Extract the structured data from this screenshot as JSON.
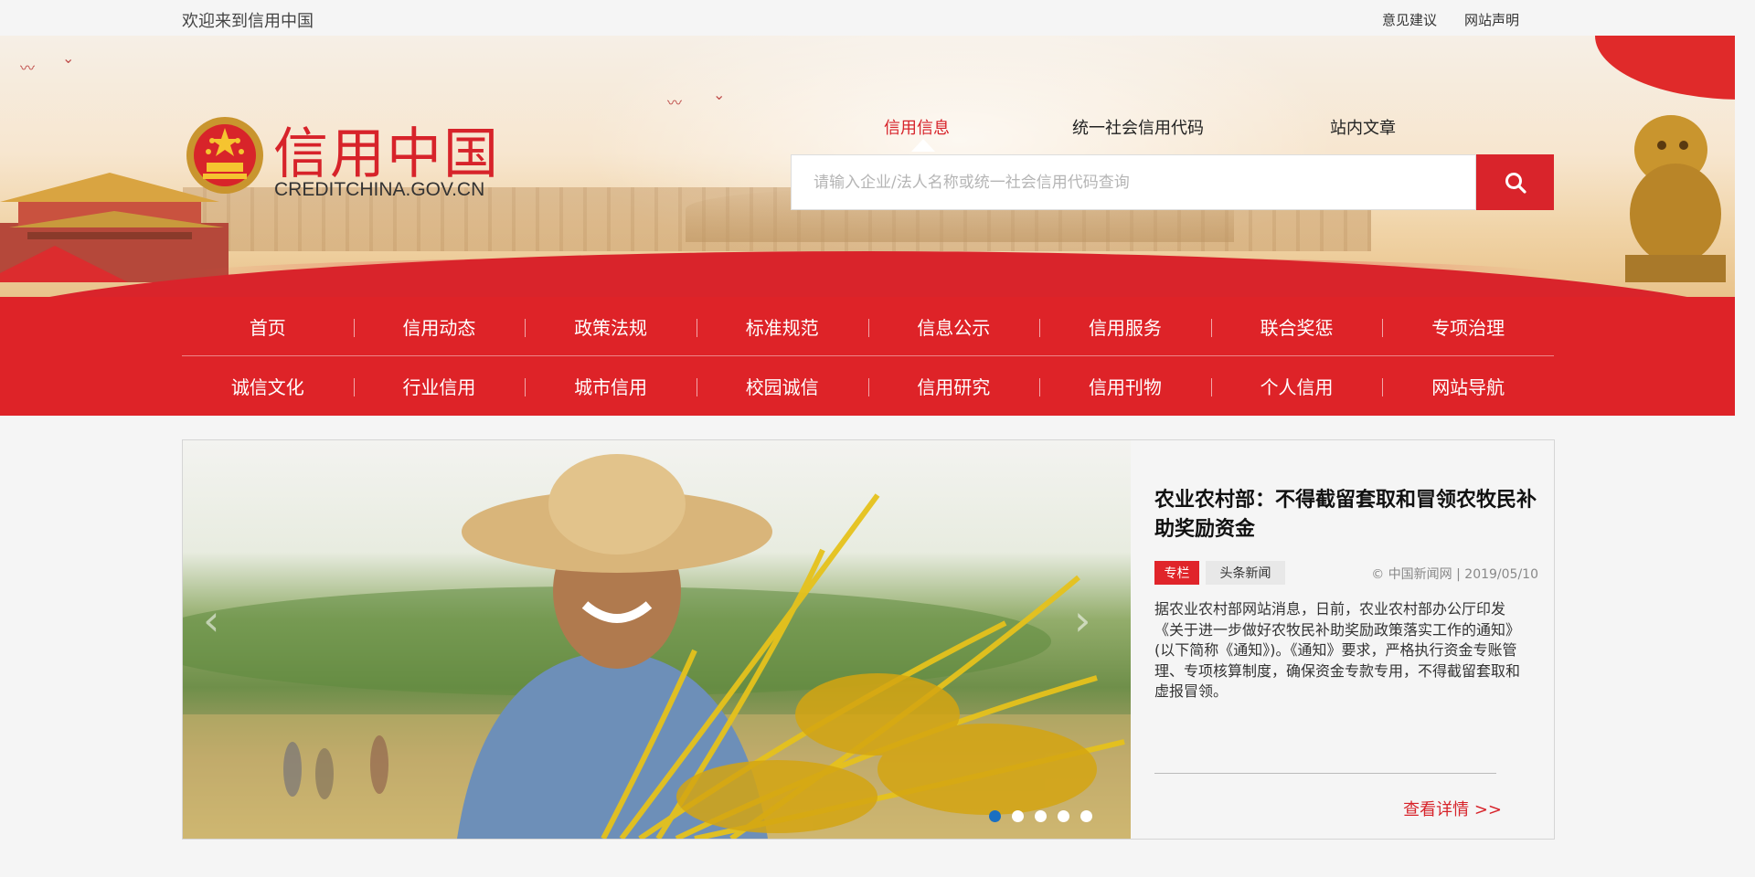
{
  "topbar": {
    "welcome": "欢迎来到信用中国",
    "links": [
      "意见建议",
      "网站声明"
    ]
  },
  "header": {
    "site_title": "信用中国",
    "site_domain": "CREDITCHINA.GOV.CN"
  },
  "search": {
    "tabs": [
      "信用信息",
      "统一社会信用代码",
      "站内文章"
    ],
    "active_tab": "信用信息",
    "placeholder": "请输入企业/法人名称或统一社会信用代码查询",
    "value": ""
  },
  "nav": {
    "row1": [
      "首页",
      "信用动态",
      "政策法规",
      "标准规范",
      "信息公示",
      "信用服务",
      "联合奖惩",
      "专项治理"
    ],
    "row2": [
      "诚信文化",
      "行业信用",
      "城市信用",
      "校园诚信",
      "信用研究",
      "信用刊物",
      "个人信用",
      "网站导航"
    ]
  },
  "featured": {
    "title": "农业农村部：不得截留套取和冒领农牧民补助奖励资金",
    "tags": [
      "专栏",
      "头条新闻"
    ],
    "source": "中国新闻网 | 2019/05/10",
    "summary": "据农业农村部网站消息，日前，农业农村部办公厅印发《关于进一步做好农牧民补助奖励政策落实工作的通知》(以下简称《通知》)。《通知》要求，严格执行资金专账管理、专项核算制度，确保资金专款专用，不得截留套取和虚报冒领。",
    "more_label": "查看详情 >>",
    "slide_count": 5,
    "active_slide": 1
  },
  "colors": {
    "brand_red": "#de2328",
    "link_red": "#d7232a",
    "active_dot": "#1a6fc2"
  },
  "icons": {
    "search_button": "search-icon",
    "prev": "chevron-left-icon",
    "next": "chevron-right-icon",
    "copyright": "copyright-icon",
    "emblem": "national-emblem-icon"
  }
}
